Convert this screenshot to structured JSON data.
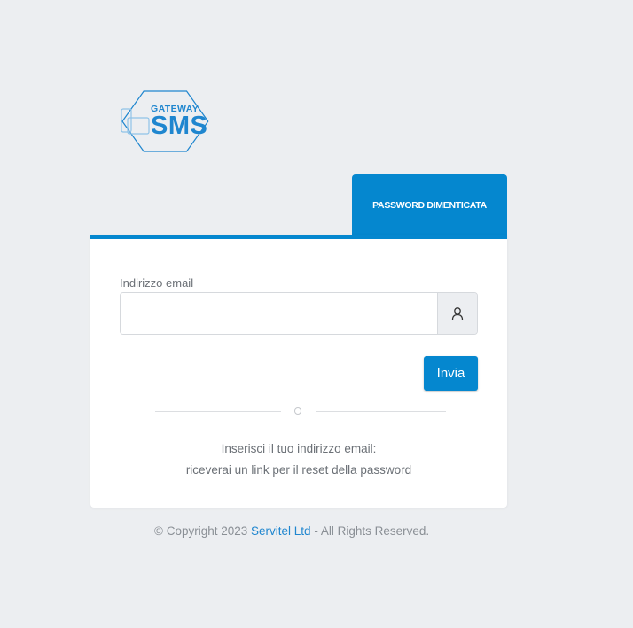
{
  "logo": {
    "line1": "GATEWAY",
    "line2": "SMS"
  },
  "tab": {
    "label": "PASSWORD DIMENTICATA"
  },
  "form": {
    "email_label": "Indirizzo email",
    "email_value": "",
    "email_placeholder": "",
    "submit_label": "Invia"
  },
  "info": {
    "line1": "Inserisci il tuo indirizzo email:",
    "line2": "riceverai un link per il reset della password"
  },
  "footer": {
    "prefix": "© Copyright 2023 ",
    "company": "Servitel Ltd",
    "suffix": " - All Rights Reserved."
  },
  "icons": {
    "user": "user-icon",
    "logo": "gateway-sms-logo"
  },
  "colors": {
    "primary": "#0587cf",
    "background": "#eceef1",
    "card": "#ffffff",
    "link": "#1f86cf"
  }
}
